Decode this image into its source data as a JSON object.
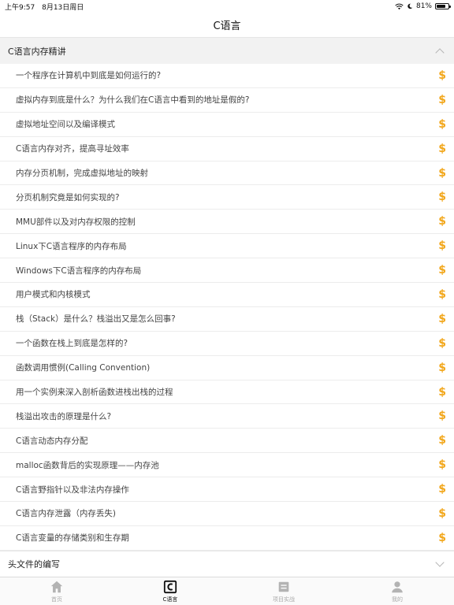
{
  "status_bar": {
    "time": "上午9:57",
    "date": "8月13日周日",
    "battery_percent": "81%",
    "battery_level": 0.81
  },
  "nav": {
    "title": "C语言"
  },
  "sections": [
    {
      "title": "C语言内存精讲",
      "expanded": true,
      "lessons": [
        "一个程序在计算机中到底是如何运行的?",
        "虚拟内存到底是什么？为什么我们在C语言中看到的地址是假的?",
        "虚拟地址空间以及编译模式",
        "C语言内存对齐，提高寻址效率",
        "内存分页机制，完成虚拟地址的映射",
        "分页机制究竟是如何实现的?",
        "MMU部件以及对内存权限的控制",
        "Linux下C语言程序的内存布局",
        "Windows下C语言程序的内存布局",
        "用户模式和内核模式",
        "栈（Stack）是什么？栈溢出又是怎么回事?",
        "一个函数在栈上到底是怎样的?",
        "函数调用惯例(Calling Convention)",
        "用一个实例来深入剖析函数进栈出栈的过程",
        "栈溢出攻击的原理是什么?",
        "C语言动态内存分配",
        "malloc函数背后的实现原理——内存池",
        "C语言野指针以及非法内存操作",
        "C语言内存泄露（内存丢失)",
        "C语言变量的存储类别和生存期"
      ]
    },
    {
      "title": "头文件的编写",
      "expanded": false
    }
  ],
  "price_symbol": "$",
  "tabs": [
    {
      "label": "首页",
      "icon": "home-icon"
    },
    {
      "label": "C语言",
      "icon": "c-language-icon"
    },
    {
      "label": "项目实战",
      "icon": "project-icon"
    },
    {
      "label": "我的",
      "icon": "profile-icon"
    }
  ],
  "colors": {
    "accent_price": "#f2a71b",
    "active_tab": "#111111",
    "inactive_tab": "#aaaaaa"
  }
}
